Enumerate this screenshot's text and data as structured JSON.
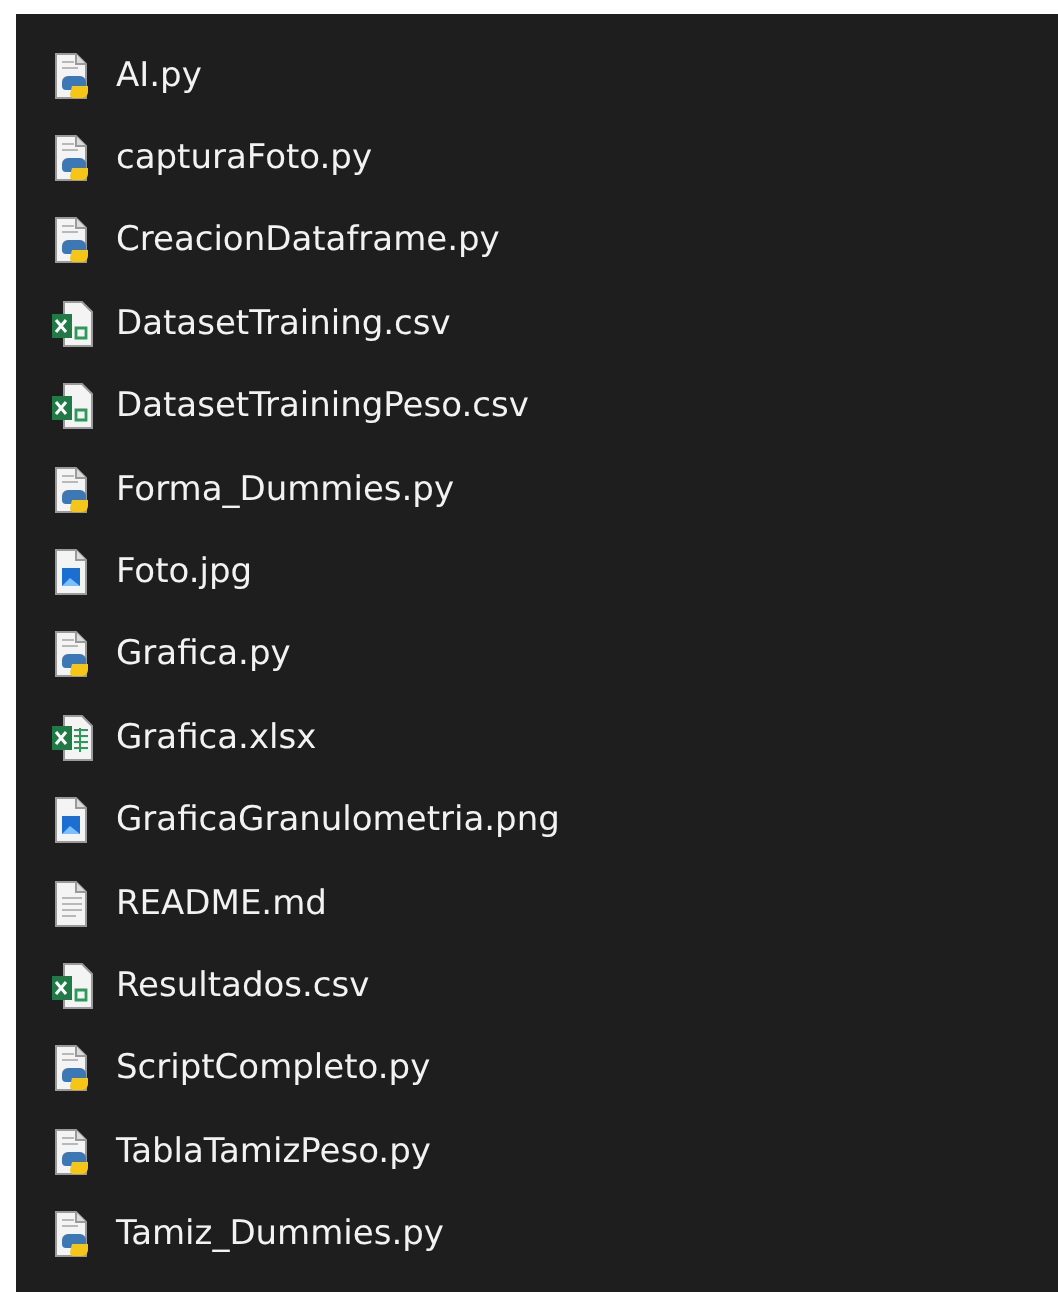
{
  "files": [
    {
      "name": "AI.py",
      "kind": "python"
    },
    {
      "name": "capturaFoto.py",
      "kind": "python"
    },
    {
      "name": "CreacionDataframe.py",
      "kind": "python"
    },
    {
      "name": "DatasetTraining.csv",
      "kind": "csv"
    },
    {
      "name": "DatasetTrainingPeso.csv",
      "kind": "csv"
    },
    {
      "name": "Forma_Dummies.py",
      "kind": "python"
    },
    {
      "name": "Foto.jpg",
      "kind": "image"
    },
    {
      "name": "Grafica.py",
      "kind": "python"
    },
    {
      "name": "Grafica.xlsx",
      "kind": "xlsx"
    },
    {
      "name": "GraficaGranulometria.png",
      "kind": "image"
    },
    {
      "name": "README.md",
      "kind": "text"
    },
    {
      "name": "Resultados.csv",
      "kind": "csv"
    },
    {
      "name": "ScriptCompleto.py",
      "kind": "python"
    },
    {
      "name": "TablaTamizPeso.py",
      "kind": "python"
    },
    {
      "name": "Tamiz_Dummies.py",
      "kind": "python"
    }
  ]
}
